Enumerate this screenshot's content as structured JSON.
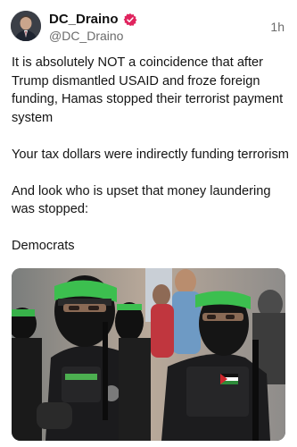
{
  "author": {
    "display_name": "DC_Draino",
    "handle": "@DC_Draino",
    "avatar_icon": "user-avatar",
    "verified_icon": "verified-badge-icon",
    "verified_color": "#e0245e"
  },
  "post": {
    "timestamp": "1h",
    "paragraphs": [
      "It is absolutely NOT a coincidence that after Trump dismantled USAID and froze foreign funding, Hamas stopped their terrorist payment system",
      "Your tax dollars were indirectly funding terrorism",
      "And look who is upset that money laundering was stopped:",
      "Democrats"
    ],
    "image_icon": "photo-masked-militants"
  }
}
